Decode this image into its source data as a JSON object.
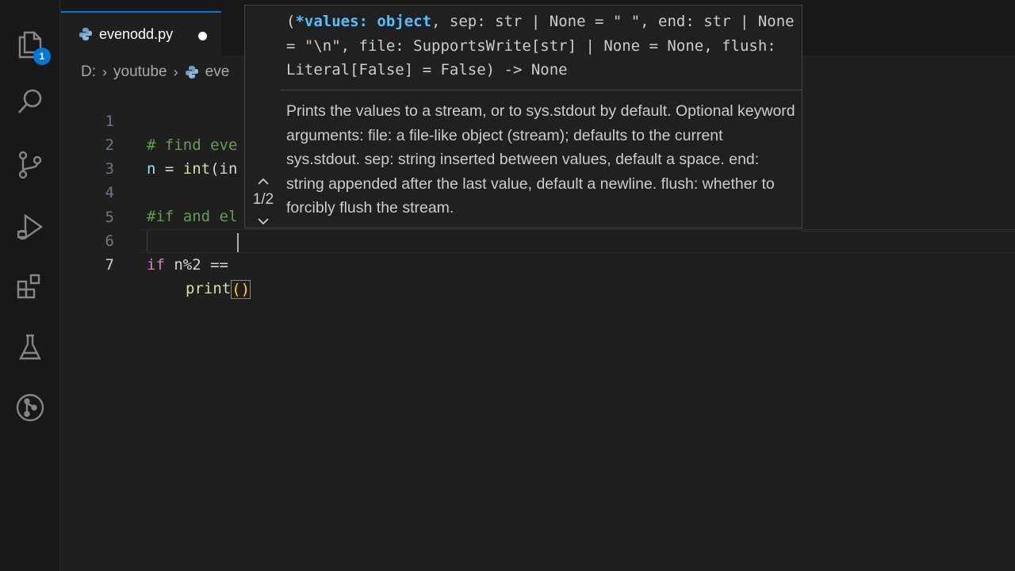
{
  "activity_bar": {
    "explorer_badge": "1",
    "icons": [
      "files-icon",
      "search-icon",
      "source-control-icon",
      "run-debug-icon",
      "extensions-icon",
      "testing-icon",
      "git-graph-icon"
    ]
  },
  "tab": {
    "label": "evenodd.py",
    "modified": true
  },
  "breadcrumbs": {
    "drive": "D:",
    "folder": "youtube",
    "file": "eve"
  },
  "lines": [
    {
      "number": "1",
      "text": "# find eve"
    },
    {
      "number": "2",
      "n": "n",
      "eq": " = ",
      "fn": "int",
      "rest": "(in"
    },
    {
      "number": "3",
      "text": ""
    },
    {
      "number": "4",
      "text": "#if and el"
    },
    {
      "number": "5",
      "text": ""
    },
    {
      "number": "6",
      "kw": "if",
      "rest": " n%2 == "
    },
    {
      "number": "7",
      "fn": "print",
      "open": "(",
      "close": ")"
    }
  ],
  "hover": {
    "signature_open": "(",
    "signature_active": "*values: object",
    "signature_rest": ", sep: str | None = \" \", end: str | None = \"\\n\", file: SupportsWrite[str] | None = None, flush: Literal[False] = False) -> None",
    "doc": "Prints the values to a stream, or to sys.stdout by default. Optional keyword arguments: file: a file-like object (stream); defaults to the current sys.stdout. sep: string inserted between values, default a space. end: string appended after the last value, default a newline. flush: whether to forcibly flush the stream.",
    "counter": "1/2"
  },
  "colors": {
    "accent": "#0078d4",
    "comment": "#6a9955",
    "keyword": "#c586c0",
    "function": "#dcdcaa",
    "variable": "#9cdcfe",
    "active_param": "#4fc1ff"
  }
}
